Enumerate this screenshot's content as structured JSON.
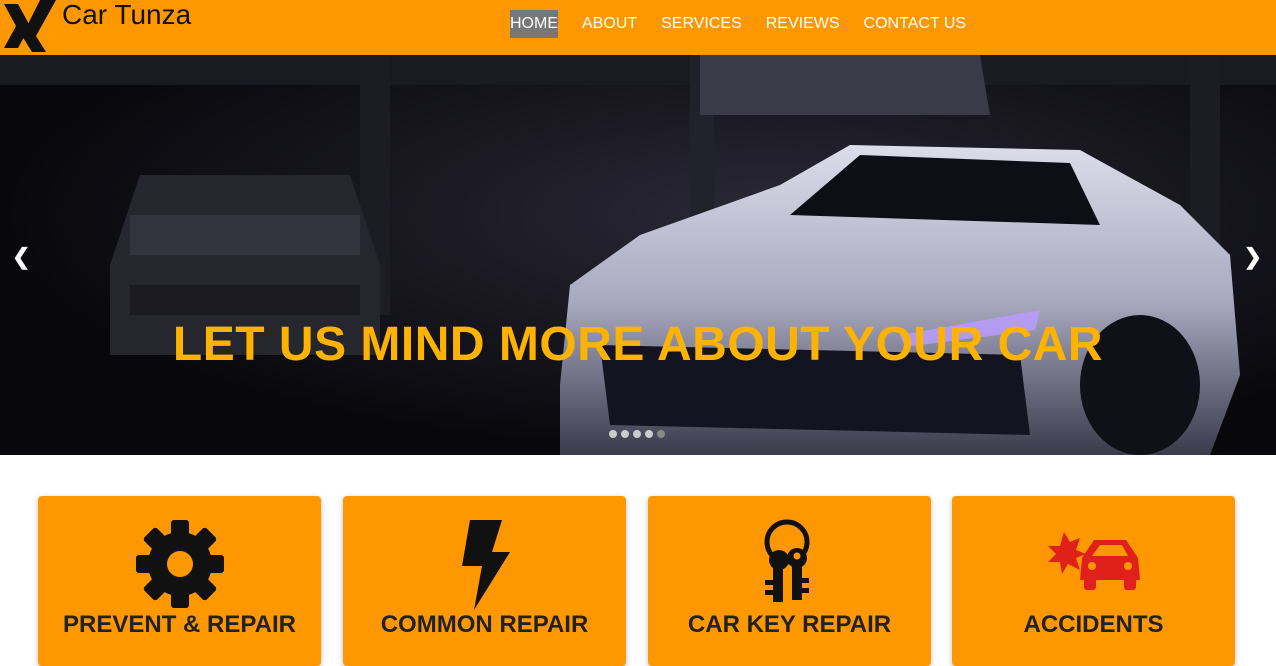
{
  "header": {
    "brand": "Car Tunza",
    "logo_icon": "x-logo-icon",
    "nav": [
      {
        "label": "HOME",
        "active": true
      },
      {
        "label": "ABOUT",
        "active": false
      },
      {
        "label": "SERVICES",
        "active": false
      },
      {
        "label": "REVIEWS",
        "active": false
      },
      {
        "label": "CONTACT US",
        "active": false
      }
    ]
  },
  "hero": {
    "title": "LET US MIND MORE ABOUT YOUR CAR",
    "prev_arrow": "❮",
    "next_arrow": "❯",
    "slide_count": 5,
    "active_slide": 1
  },
  "services": [
    {
      "label": "PREVENT & REPAIR",
      "icon": "gear-icon"
    },
    {
      "label": "COMMON REPAIR",
      "icon": "lightning-bolt-icon"
    },
    {
      "label": "CAR KEY REPAIR",
      "icon": "car-keys-icon"
    },
    {
      "label": "ACCIDENTS",
      "icon": "car-crash-icon"
    }
  ],
  "colors": {
    "header_bg": "#ff9800",
    "hero_text": "#ffb300",
    "card_bg": "#ff9800",
    "crash_icon": "#e0201a"
  }
}
